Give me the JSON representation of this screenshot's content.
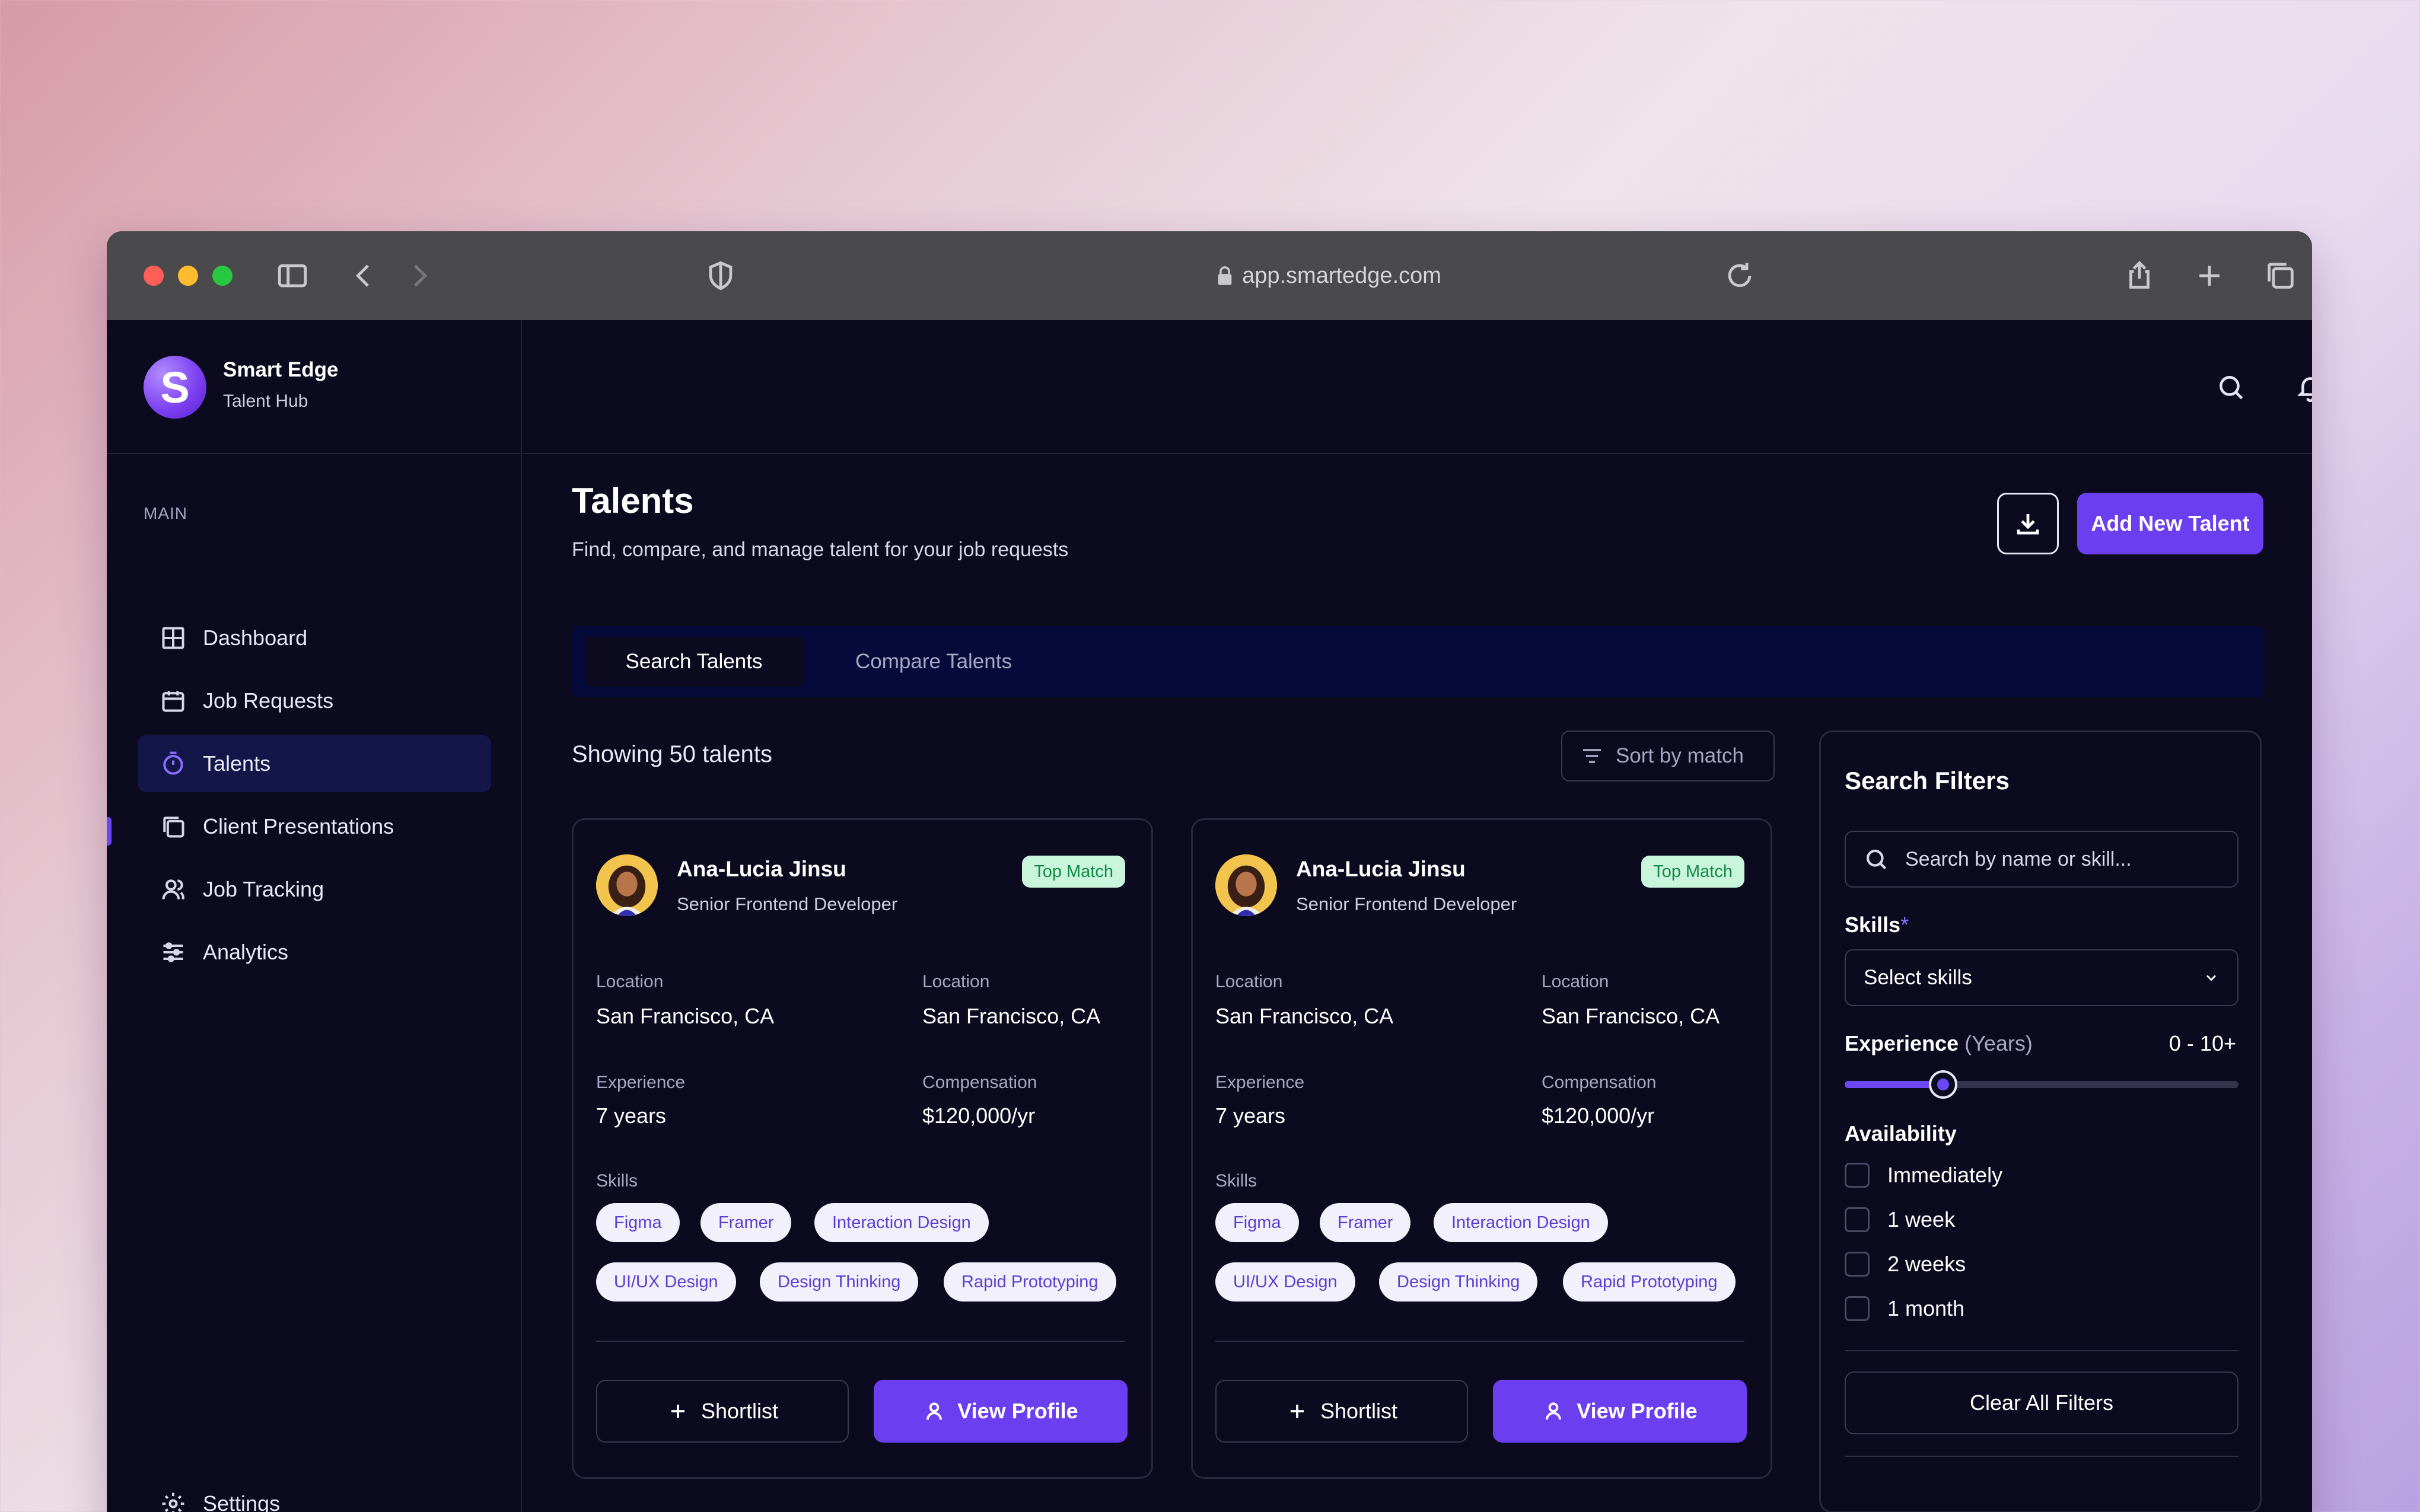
{
  "browser": {
    "url": "app.smartedge.com",
    "traffic_lights": {
      "close": "#ff5f57",
      "minimize": "#febc2e",
      "zoom": "#28c840"
    }
  },
  "brand": {
    "name": "Smart Edge",
    "subtitle": "Talent Hub",
    "logo_letter": "S"
  },
  "sidebar": {
    "section": "MAIN",
    "items": [
      {
        "label": "Dashboard",
        "icon": "grid-icon"
      },
      {
        "label": "Job Requests",
        "icon": "calendar-icon"
      },
      {
        "label": "Talents",
        "icon": "timer-icon",
        "active": true
      },
      {
        "label": "Client Presentations",
        "icon": "copy-icon"
      },
      {
        "label": "Job Tracking",
        "icon": "users-icon"
      },
      {
        "label": "Analytics",
        "icon": "sliders-icon"
      }
    ],
    "settings_label": "Settings"
  },
  "header": {
    "title": "Talents",
    "subtitle": "Find, compare, and manage talent for your job requests",
    "add_button": "Add New Talent"
  },
  "tabs": [
    {
      "label": "Search Talents",
      "active": true
    },
    {
      "label": "Compare Talents",
      "active": false
    }
  ],
  "results": {
    "showing": "Showing 50 talents",
    "sort_label": "Sort by match"
  },
  "cards": [
    {
      "name": "Ana-Lucia Jinsu",
      "role": "Senior Frontend Developer",
      "badge": "Top Match",
      "location_label_1": "Location",
      "location_1": "San Francisco, CA",
      "location_label_2": "Location",
      "location_2": "San Francisco, CA",
      "experience_label": "Experience",
      "experience": "7 years",
      "compensation_label": "Compensation",
      "compensation": "$120,000/yr",
      "skills_label": "Skills",
      "skills": [
        "Figma",
        "Framer",
        "Interaction Design",
        "UI/UX Design",
        "Design Thinking",
        "Rapid Prototyping"
      ],
      "shortlist": "Shortlist",
      "view_profile": "View Profile"
    },
    {
      "name": "Ana-Lucia Jinsu",
      "role": "Senior Frontend Developer",
      "badge": "Top Match",
      "location_label_1": "Location",
      "location_1": "San Francisco, CA",
      "location_label_2": "Location",
      "location_2": "San Francisco, CA",
      "experience_label": "Experience",
      "experience": "7 years",
      "compensation_label": "Compensation",
      "compensation": "$120,000/yr",
      "skills_label": "Skills",
      "skills": [
        "Figma",
        "Framer",
        "Interaction Design",
        "UI/UX Design",
        "Design Thinking",
        "Rapid Prototyping"
      ],
      "shortlist": "Shortlist",
      "view_profile": "View Profile"
    }
  ],
  "filters": {
    "title": "Search Filters",
    "search_placeholder": "Search by name or skill...",
    "skills_label": "Skills",
    "skills_required": "*",
    "skills_select": "Select skills",
    "experience_label": "Experience",
    "experience_unit": "(Years)",
    "experience_range": "0 - 10+",
    "experience_slider_fraction": 0.25,
    "availability_label": "Availability",
    "availability_options": [
      "Immediately",
      "1 week",
      "2 weeks",
      "1 month"
    ],
    "clear_button": "Clear All Filters"
  }
}
